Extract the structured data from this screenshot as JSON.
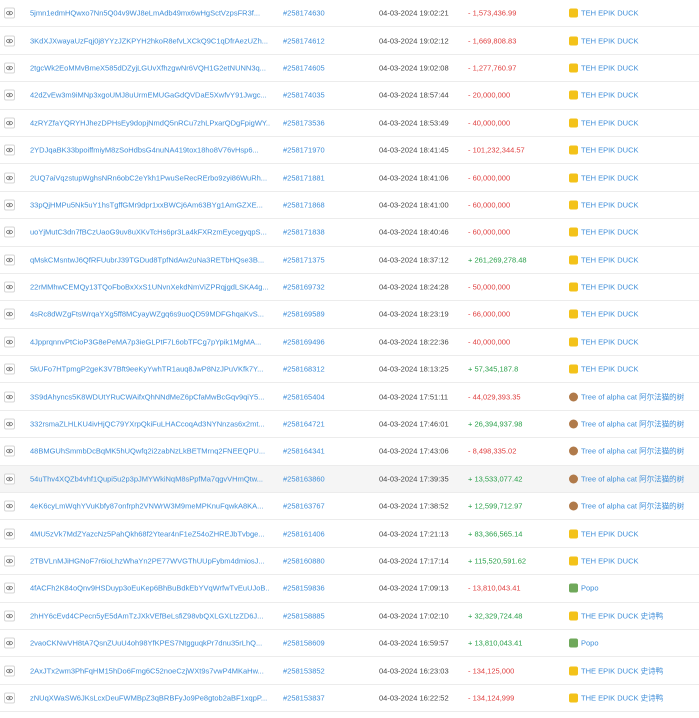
{
  "rows": [
    {
      "sig": "5jmn1edmHQwxo7Nn5Q04v9WJ8eLmAdb49mx6wHgSctVzpsFR3f...",
      "block": "#258174630",
      "time": "04-03-2024 19:02:21",
      "amount": "- 1,573,436.99",
      "sign": "neg",
      "token": "TEH EPIK DUCK",
      "icon": "duck"
    },
    {
      "sig": "3KdXJXwayaUzFqj0j8YYzJZKPYH2hkoR8efvLXCkQ9C1qDfrAezUZh...",
      "block": "#258174612",
      "time": "04-03-2024 19:02:12",
      "amount": "- 1,669,808.83",
      "sign": "neg",
      "token": "TEH EPIK DUCK",
      "icon": "duck"
    },
    {
      "sig": "2tgcWk2EoMMvBmeX585dDZyjLGUvXfhzgwNr6VQH1G2etNUNN3q...",
      "block": "#258174605",
      "time": "04-03-2024 19:02:08",
      "amount": "- 1,277,760.97",
      "sign": "neg",
      "token": "TEH EPIK DUCK",
      "icon": "duck"
    },
    {
      "sig": "42dZvEw3m9iMNp3xgoUMJ8uUrmEMUGaGdQVDaE5XwfvY91Jwgc...",
      "block": "#258174035",
      "time": "04-03-2024 18:57:44",
      "amount": "- 20,000,000",
      "sign": "neg",
      "token": "TEH EPIK DUCK",
      "icon": "duck"
    },
    {
      "sig": "4zRYZfaYQRYHJhezDPHsEy9dopjNmdQ5nRCu7zhLPxarQDgFpigWY...",
      "block": "#258173536",
      "time": "04-03-2024 18:53:49",
      "amount": "- 40,000,000",
      "sign": "neg",
      "token": "TEH EPIK DUCK",
      "icon": "duck"
    },
    {
      "sig": "2YDJqaBK33bpoiffmiyM8zSoHdbsG4nuNA419tox18ho8V76vHsp6...",
      "block": "#258171970",
      "time": "04-03-2024 18:41:45",
      "amount": "- 101,232,344.57",
      "sign": "neg",
      "token": "TEH EPIK DUCK",
      "icon": "duck"
    },
    {
      "sig": "2UQ7aiVqzstupWghsNRn6obC2eYkh1PwuSeRecRErbo9zyi86WuRh...",
      "block": "#258171881",
      "time": "04-03-2024 18:41:06",
      "amount": "- 60,000,000",
      "sign": "neg",
      "token": "TEH EPIK DUCK",
      "icon": "duck"
    },
    {
      "sig": "33pQjHMPu5Nk5uY1hsTgffGMr9dpr1xxBWCj6Am63BYg1AmGZXE...",
      "block": "#258171868",
      "time": "04-03-2024 18:41:00",
      "amount": "- 60,000,000",
      "sign": "neg",
      "token": "TEH EPIK DUCK",
      "icon": "duck"
    },
    {
      "sig": "uoYjMutC3dn7fBCzUaoG9uv8uXKvTcHs6pr3La4kFXRzmEycegyqpS...",
      "block": "#258171838",
      "time": "04-03-2024 18:40:46",
      "amount": "- 60,000,000",
      "sign": "neg",
      "token": "TEH EPIK DUCK",
      "icon": "duck"
    },
    {
      "sig": "qMskCMsntwJ6QfRFUubrJ39TGDud8TpfNdAw2uNa3RETbHQse3B...",
      "block": "#258171375",
      "time": "04-03-2024 18:37:12",
      "amount": "+ 261,269,278.48",
      "sign": "pos",
      "token": "TEH EPIK DUCK",
      "icon": "duck"
    },
    {
      "sig": "22rMMhwCEMQy13TQoFboBxXxS1UNvnXekdNmViZPRqjgdLSKA4g...",
      "block": "#258169732",
      "time": "04-03-2024 18:24:28",
      "amount": "- 50,000,000",
      "sign": "neg",
      "token": "TEH EPIK DUCK",
      "icon": "duck"
    },
    {
      "sig": "4sRc8dWZgFtsWrqaYXg5ff8MCyayWZgq6s9uoQD59MDFGhqaKvS...",
      "block": "#258169589",
      "time": "04-03-2024 18:23:19",
      "amount": "- 66,000,000",
      "sign": "neg",
      "token": "TEH EPIK DUCK",
      "icon": "duck"
    },
    {
      "sig": "4JpprqnnvPtCioP3G8ePeMA7p3ieGLPtF7L6obTFCg7pYpik1MgMA...",
      "block": "#258169496",
      "time": "04-03-2024 18:22:36",
      "amount": "- 40,000,000",
      "sign": "neg",
      "token": "TEH EPIK DUCK",
      "icon": "duck"
    },
    {
      "sig": "5kUFo7HTpmgP2geK3V7Bft9eeKyYwhTR1auq8JwP8NzJPuVKfk7Y...",
      "block": "#258168312",
      "time": "04-03-2024 18:13:25",
      "amount": "+ 57,345,187.8",
      "sign": "pos",
      "token": "TEH EPIK DUCK",
      "icon": "duck"
    },
    {
      "sig": "3S9dAhyncs5K8WDUtYRuCWAifxQhNNdMeZ6pCfaMwBcGqv9qiY5...",
      "block": "#258165404",
      "time": "04-03-2024 17:51:11",
      "amount": "- 44,029,393.35",
      "sign": "neg",
      "token": "Tree of alpha cat 阿尔法猫的树",
      "icon": "cat"
    },
    {
      "sig": "332rsmaZLHLKU4ivHjQC79YXrpQkiFuLHACcoqAd3NYNnzas6x2mt...",
      "block": "#258164721",
      "time": "04-03-2024 17:46:01",
      "amount": "+ 26,394,937.98",
      "sign": "pos",
      "token": "Tree of alpha cat 阿尔法猫的树",
      "icon": "cat"
    },
    {
      "sig": "48BMGUhSmmbDcBqMK5hUQwfq2i2zabNzLkBETMrnq2FNEEQPU...",
      "block": "#258164341",
      "time": "04-03-2024 17:43:06",
      "amount": "- 8,498,335.02",
      "sign": "neg",
      "token": "Tree of alpha cat 阿尔法猫的树",
      "icon": "cat"
    },
    {
      "sig": "54uThv4XQZb4vhf1Qupi5u2p3pJMYWkiNqM8sPpfMa7qgvVHmQtw...",
      "block": "#258163860",
      "time": "04-03-2024 17:39:35",
      "amount": "+ 13,533,077.42",
      "sign": "pos",
      "token": "Tree of alpha cat 阿尔法猫的树",
      "icon": "cat",
      "hl": true
    },
    {
      "sig": "4eK6cyLmWqhYVuKbfy87onfrph2VNWrW3M9meMPKnuFqwkA8KA...",
      "block": "#258163767",
      "time": "04-03-2024 17:38:52",
      "amount": "+ 12,599,712.97",
      "sign": "pos",
      "token": "Tree of alpha cat 阿尔法猫的树",
      "icon": "cat"
    },
    {
      "sig": "4MU5zVk7MdZYazcNz5PahQkh68f2Ytear4nF1eZ54oZHREJbTvbge...",
      "block": "#258161406",
      "time": "04-03-2024 17:21:13",
      "amount": "+ 83,366,565.14",
      "sign": "pos",
      "token": "TEH EPIK DUCK",
      "icon": "duck"
    },
    {
      "sig": "2TBVLnMJiHGNoF7r6ioLhzWhaYn2PE77WVGThUUpFybm4dmiosJ...",
      "block": "#258160880",
      "time": "04-03-2024 17:17:14",
      "amount": "+ 115,520,591.62",
      "sign": "pos",
      "token": "TEH EPIK DUCK",
      "icon": "duck"
    },
    {
      "sig": "4fACFh2K84oQnv9HSDuyp3oEuKep6BhBuBdkEbYVqWrfwTvEuUJoB...",
      "block": "#258159836",
      "time": "04-03-2024 17:09:13",
      "amount": "- 13,810,043.41",
      "sign": "neg",
      "token": "Popo",
      "icon": "popo"
    },
    {
      "sig": "2hHY6cEvd4CPecn5yE5dAmTzJXkVEfBeLsfiZ98vbQXLGXLtzZD6J...",
      "block": "#258158885",
      "time": "04-03-2024 17:02:10",
      "amount": "+ 32,329,724.48",
      "sign": "pos",
      "token": "THE EPIK DUCK 史诗鸭",
      "icon": "duck"
    },
    {
      "sig": "2vaoCKNwVH8tA7QsnZUuU4oh98YfKPES7NtgguqkPr7dnu35rLhQ...",
      "block": "#258158609",
      "time": "04-03-2024 16:59:57",
      "amount": "+ 13,810,043.41",
      "sign": "pos",
      "token": "Popo",
      "icon": "popo"
    },
    {
      "sig": "2AxJTx2wm3PhFqHM15hDo6Fmg6C52noeCzjWXt9s7vwP4MKaHw...",
      "block": "#258153852",
      "time": "04-03-2024 16:23:03",
      "amount": "- 134,125,000",
      "sign": "neg",
      "token": "THE EPIK DUCK 史诗鸭",
      "icon": "duck"
    },
    {
      "sig": "zNUqXWaSW6JKsLcxDeuFWMBpZ3qBRBFyJo9Pe8gtob2aBF1xqpP...",
      "block": "#258153837",
      "time": "04-03-2024 16:22:52",
      "amount": "- 134,124,999",
      "sign": "neg",
      "token": "THE EPIK DUCK 史诗鸭",
      "icon": "duck"
    }
  ]
}
